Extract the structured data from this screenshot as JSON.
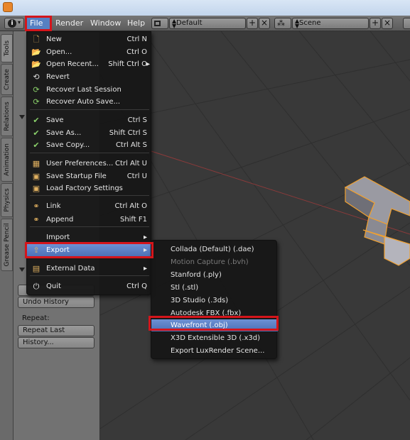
{
  "header": {
    "menus": [
      "File",
      "Render",
      "Window",
      "Help"
    ],
    "layout_value": "Default",
    "scene_value": "Scene"
  },
  "left_tabs": [
    "Tools",
    "Create",
    "Relations",
    "Animation",
    "Physics",
    "Grease Pencil"
  ],
  "tool_shelf": {
    "buttons": [
      "Undo History",
      "Repeat Last",
      "History..."
    ],
    "repeat_label": "Repeat:"
  },
  "file_menu": {
    "items": [
      {
        "label": "New",
        "shortcut": "Ctrl N",
        "icon": "new-file-icon"
      },
      {
        "label": "Open...",
        "shortcut": "Ctrl O",
        "icon": "folder-open-icon"
      },
      {
        "label": "Open Recent...",
        "shortcut": "Shift Ctrl O",
        "icon": "open-recent-icon"
      },
      {
        "label": "Revert",
        "shortcut": "",
        "icon": "revert-icon"
      },
      {
        "label": "Recover Last Session",
        "shortcut": "",
        "icon": "recover-icon"
      },
      {
        "label": "Recover Auto Save...",
        "shortcut": "",
        "icon": "recover-autosave-icon"
      },
      {
        "label": "Save",
        "shortcut": "Ctrl S",
        "icon": "checkmark-icon"
      },
      {
        "label": "Save As...",
        "shortcut": "Shift Ctrl S",
        "icon": "checkmark-icon"
      },
      {
        "label": "Save Copy...",
        "shortcut": "Ctrl Alt S",
        "icon": "save-copy-icon"
      },
      {
        "label": "User Preferences...",
        "shortcut": "Ctrl Alt U",
        "icon": "preferences-icon"
      },
      {
        "label": "Save Startup File",
        "shortcut": "Ctrl U",
        "icon": "save-startup-icon"
      },
      {
        "label": "Load Factory Settings",
        "shortcut": "",
        "icon": "factory-settings-icon"
      },
      {
        "label": "Link",
        "shortcut": "Ctrl Alt O",
        "icon": "link-icon"
      },
      {
        "label": "Append",
        "shortcut": "Shift F1",
        "icon": "append-icon"
      },
      {
        "label": "Import",
        "shortcut": "",
        "icon": ""
      },
      {
        "label": "Export",
        "shortcut": "",
        "icon": "export-icon"
      },
      {
        "label": "External Data",
        "shortcut": "",
        "icon": "external-data-icon"
      },
      {
        "label": "Quit",
        "shortcut": "Ctrl Q",
        "icon": "power-icon"
      }
    ]
  },
  "export_submenu": {
    "items": [
      {
        "label": "Collada (Default) (.dae)",
        "disabled": false
      },
      {
        "label": "Motion Capture (.bvh)",
        "disabled": true
      },
      {
        "label": "Stanford (.ply)",
        "disabled": false
      },
      {
        "label": "Stl (.stl)",
        "disabled": false
      },
      {
        "label": "3D Studio (.3ds)",
        "disabled": false
      },
      {
        "label": "Autodesk FBX (.fbx)",
        "disabled": false
      },
      {
        "label": "Wavefront (.obj)",
        "disabled": false
      },
      {
        "label": "X3D Extensible 3D (.x3d)",
        "disabled": false
      },
      {
        "label": "Export LuxRender Scene...",
        "disabled": false
      }
    ]
  },
  "colors": {
    "highlight": "#5680c2",
    "annotation_red": "#d4151b",
    "selection_orange": "#f0a030"
  }
}
